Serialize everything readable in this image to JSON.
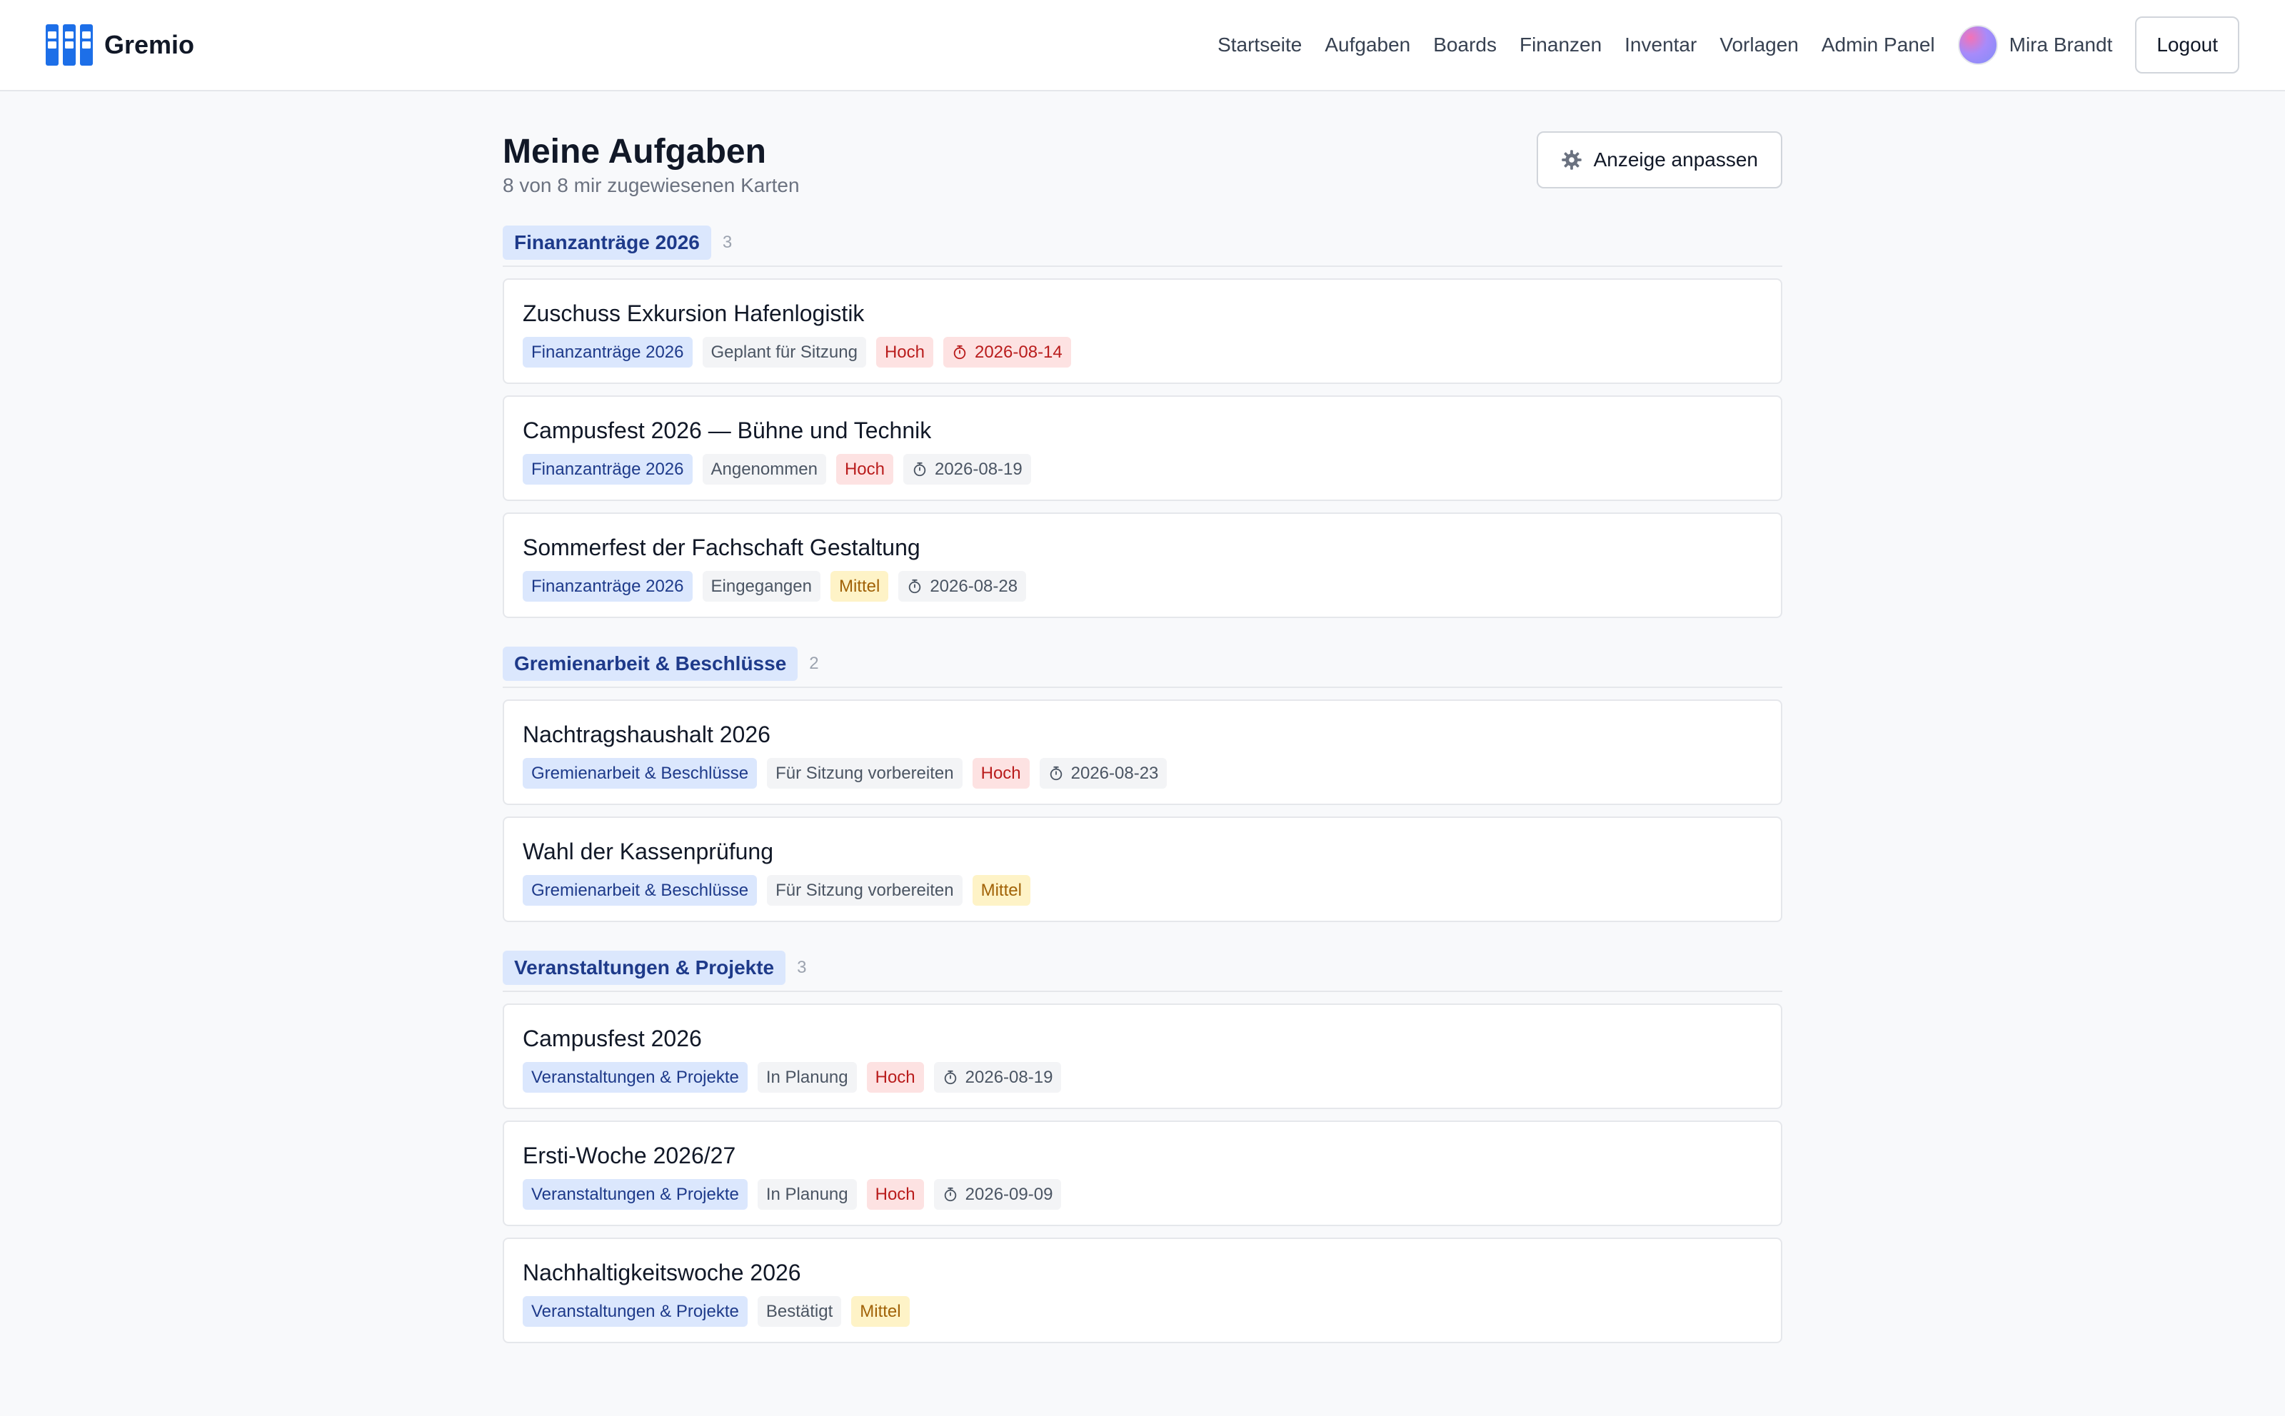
{
  "app": {
    "name": "Gremio"
  },
  "nav": {
    "links": [
      "Startseite",
      "Aufgaben",
      "Boards",
      "Finanzen",
      "Inventar",
      "Vorlagen",
      "Admin Panel"
    ],
    "user_name": "Mira Brandt",
    "logout_label": "Logout"
  },
  "page": {
    "title": "Meine Aufgaben",
    "subtitle": "8 von 8 mir zugewiesenen Karten",
    "settings_label": "Anzeige anpassen"
  },
  "colors": {
    "accent": "#1d6fe8",
    "board_tag_bg": "#dbe7fd",
    "priority_high_bg": "#fde2e2",
    "priority_medium_bg": "#fef3c7"
  },
  "groups": [
    {
      "title": "Finanzanträge 2026",
      "count": "3",
      "cards": [
        {
          "title": "Zuschuss Exkursion Hafenlogistik",
          "board": "Finanzanträge 2026",
          "status": "Geplant für Sitzung",
          "priority": "Hoch",
          "due": "2026-08-14",
          "overdue": true
        },
        {
          "title": "Campusfest 2026 — Bühne und Technik",
          "board": "Finanzanträge 2026",
          "status": "Angenommen",
          "priority": "Hoch",
          "due": "2026-08-19",
          "overdue": false
        },
        {
          "title": "Sommerfest der Fachschaft Gestaltung",
          "board": "Finanzanträge 2026",
          "status": "Eingegangen",
          "priority": "Mittel",
          "due": "2026-08-28",
          "overdue": false
        }
      ]
    },
    {
      "title": "Gremienarbeit & Beschlüsse",
      "count": "2",
      "cards": [
        {
          "title": "Nachtragshaushalt 2026",
          "board": "Gremienarbeit & Beschlüsse",
          "status": "Für Sitzung vorbereiten",
          "priority": "Hoch",
          "due": "2026-08-23",
          "overdue": false
        },
        {
          "title": "Wahl der Kassenprüfung",
          "board": "Gremienarbeit & Beschlüsse",
          "status": "Für Sitzung vorbereiten",
          "priority": "Mittel",
          "due": null,
          "overdue": false
        }
      ]
    },
    {
      "title": "Veranstaltungen & Projekte",
      "count": "3",
      "cards": [
        {
          "title": "Campusfest 2026",
          "board": "Veranstaltungen & Projekte",
          "status": "In Planung",
          "priority": "Hoch",
          "due": "2026-08-19",
          "overdue": false
        },
        {
          "title": "Ersti-Woche 2026/27",
          "board": "Veranstaltungen & Projekte",
          "status": "In Planung",
          "priority": "Hoch",
          "due": "2026-09-09",
          "overdue": false
        },
        {
          "title": "Nachhaltigkeitswoche 2026",
          "board": "Veranstaltungen & Projekte",
          "status": "Bestätigt",
          "priority": "Mittel",
          "due": null,
          "overdue": false
        }
      ]
    }
  ]
}
